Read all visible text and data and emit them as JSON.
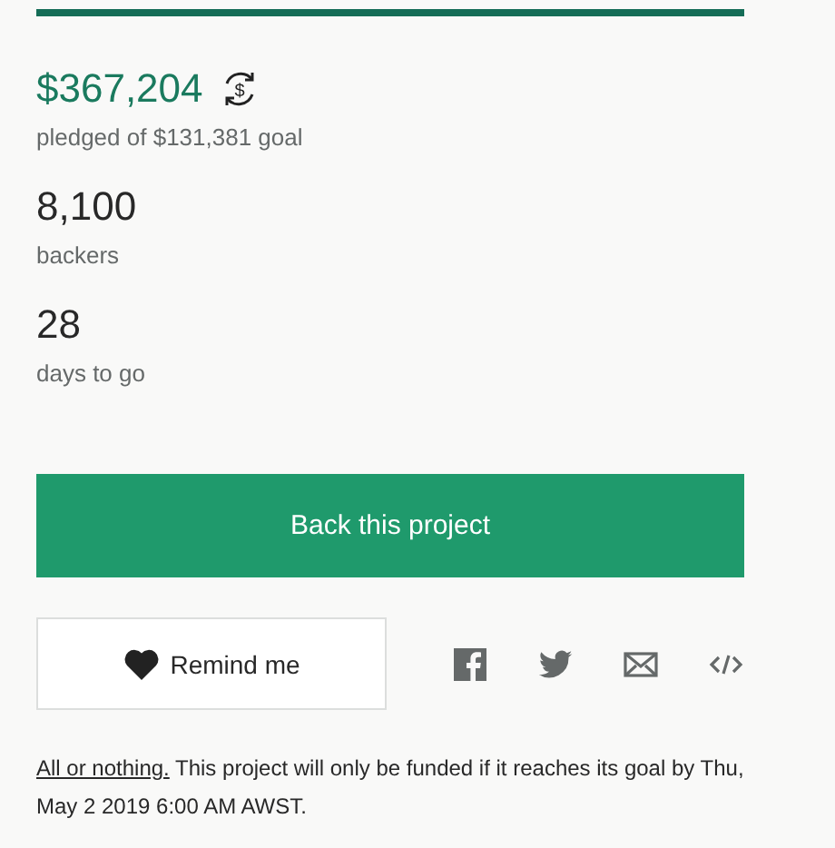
{
  "progress": {
    "level": 1
  },
  "pledged": {
    "amount": "$367,204",
    "currency_icon": "$",
    "label": "pledged of $131,381 goal"
  },
  "stats": [
    {
      "value": "8,100",
      "label": "backers"
    },
    {
      "value": "28",
      "label": "days to go"
    }
  ],
  "back_button": "Back this project",
  "remind_button": "Remind me",
  "share_icons": [
    {
      "kind": "facebook"
    },
    {
      "kind": "twitter"
    },
    {
      "kind": "email"
    },
    {
      "kind": "embed"
    }
  ],
  "notice": {
    "link": "All or nothing.",
    "text": "This project will only be funded if it reaches its goal by Thu, May 2 2019 6:00 AM AWST."
  }
}
